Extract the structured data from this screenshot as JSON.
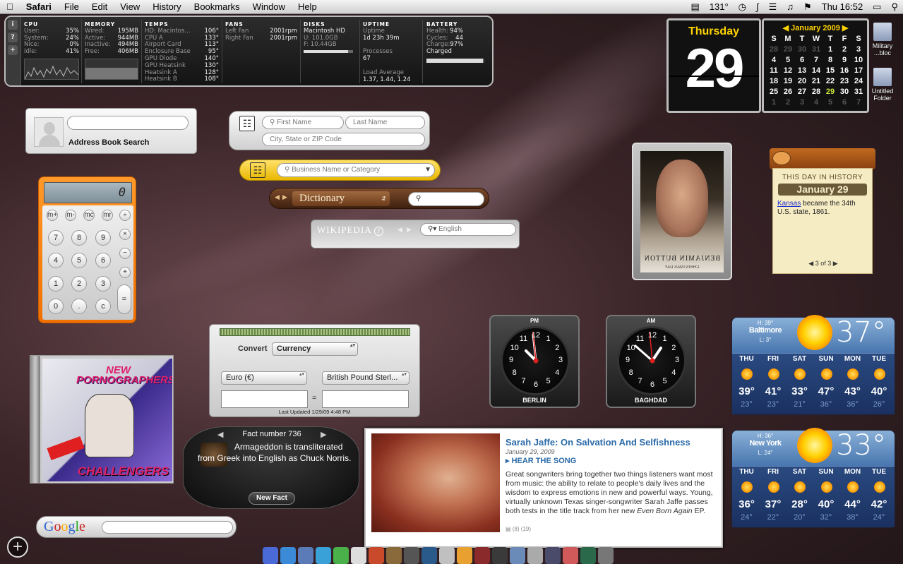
{
  "menubar": {
    "app": "Safari",
    "menus": [
      "File",
      "Edit",
      "View",
      "History",
      "Bookmarks",
      "Window",
      "Help"
    ],
    "temp": "131°",
    "clock": "Thu 16:52"
  },
  "istat": {
    "cpu": {
      "title": "CPU",
      "rows": [
        [
          "User:",
          "35%"
        ],
        [
          "System:",
          "24%"
        ],
        [
          "Nice:",
          "0%"
        ],
        [
          "Idle:",
          "41%"
        ]
      ]
    },
    "memory": {
      "title": "MEMORY",
      "rows": [
        [
          "Wired:",
          "195MB"
        ],
        [
          "Active:",
          "944MB"
        ],
        [
          "Inactive:",
          "494MB"
        ],
        [
          "Free:",
          "406MB"
        ]
      ]
    },
    "temps": {
      "title": "TEMPS",
      "rows": [
        [
          "HD: Macintos...",
          "106°"
        ],
        [
          "CPU A",
          "133°"
        ],
        [
          "Airport Card",
          "113°"
        ],
        [
          "Enclosure Base",
          "95°"
        ],
        [
          "GPU Diode",
          "140°"
        ],
        [
          "GPU Heatsink",
          "130°"
        ],
        [
          "Heatsink A",
          "128°"
        ],
        [
          "Heatsink B",
          "108°"
        ]
      ]
    },
    "fans": {
      "title": "FANS",
      "rows": [
        [
          "Left Fan",
          "2001rpm"
        ],
        [
          "Right Fan",
          "2001rpm"
        ]
      ]
    },
    "disks": {
      "title": "DISKS",
      "name": "Macintosh HD",
      "used": "U: 101.0GB",
      "free": "F: 10.44GB"
    },
    "uptime": {
      "title": "UPTIME",
      "label": "Uptime",
      "value": "1d 23h 39m",
      "proc_label": "Processes",
      "proc": "67",
      "load_label": "Load Average",
      "load": "1.37, 1.44, 1.24"
    },
    "battery": {
      "title": "BATTERY",
      "rows": [
        [
          "Health:",
          "94%"
        ],
        [
          "Cycles:",
          "44"
        ],
        [
          "Charge:",
          "97%"
        ]
      ],
      "status": "Charged"
    }
  },
  "calendar": {
    "weekday": "Thursday",
    "day": "29",
    "month": "January 2009",
    "headers": [
      "S",
      "M",
      "T",
      "W",
      "T",
      "F",
      "S"
    ],
    "weeks": [
      [
        "28",
        "29",
        "30",
        "31",
        "1",
        "2",
        "3"
      ],
      [
        "4",
        "5",
        "6",
        "7",
        "8",
        "9",
        "10"
      ],
      [
        "11",
        "12",
        "13",
        "14",
        "15",
        "16",
        "17"
      ],
      [
        "18",
        "19",
        "20",
        "21",
        "22",
        "23",
        "24"
      ],
      [
        "25",
        "26",
        "27",
        "28",
        "29",
        "30",
        "31"
      ],
      [
        "1",
        "2",
        "3",
        "4",
        "5",
        "6",
        "7"
      ]
    ]
  },
  "address_book": {
    "label": "Address Book Search"
  },
  "people": {
    "first": "First Name",
    "last": "Last Name",
    "city": "City, State or ZIP Code"
  },
  "business": {
    "placeholder": "Business Name or Category"
  },
  "dictionary": {
    "source": "Dictionary"
  },
  "wikipedia": {
    "logo": "WIKIPEDIA",
    "lang": "English"
  },
  "movie": {
    "title": "BENJAMIN BUTTON",
    "date": "CHRISTMAS DAY"
  },
  "history": {
    "heading": "THIS DAY IN HISTORY",
    "date": "January 29",
    "link": "Kansas",
    "text": " became the 34th U.S. state, 1861.",
    "pager": "3 of 3"
  },
  "calculator": {
    "display": "0",
    "mem": [
      "m+",
      "m-",
      "mc",
      "mr"
    ],
    "ops": [
      "÷",
      "×",
      "−",
      "+",
      "="
    ],
    "keys": [
      "7",
      "8",
      "9",
      "4",
      "5",
      "6",
      "1",
      "2",
      "3",
      "0",
      ".",
      "c"
    ]
  },
  "currency": {
    "convert_label": "Convert",
    "type": "Currency",
    "from": "Euro (€)",
    "to": "British Pound Sterl...",
    "updated": "Last Updated 1/29/09 4:48 PM"
  },
  "album": {
    "line1": "NEW",
    "line2": "PORNOGRAPHERS",
    "line3": "CHALLENGERS"
  },
  "clocks": [
    {
      "ampm": "PM",
      "city": "BERLIN"
    },
    {
      "ampm": "AM",
      "city": "BAGHDAD"
    }
  ],
  "clock_numbers": [
    "12",
    "1",
    "2",
    "3",
    "4",
    "5",
    "6",
    "7",
    "8",
    "9",
    "10",
    "11"
  ],
  "fact": {
    "header": "Fact number 736",
    "text": "Armageddon is transliterated from Greek into English as Chuck Norris.",
    "button": "New Fact"
  },
  "npr": {
    "title": "Sarah Jaffe: On Salvation And Selfishness",
    "date": "January 29, 2009",
    "hear": "HEAR THE SONG",
    "body": "Great songwriters bring together two things listeners want most from music: the ability to relate to people's daily lives and the wisdom to express emotions in new and powerful ways. Young, virtually unknown Texas singer-songwriter Sarah Jaffe passes both tests in the title track from her new ",
    "album": "Even Born Again",
    "tail": " EP.",
    "meta": "(8)  (19)"
  },
  "weather": [
    {
      "city": "Baltimore",
      "hilo_hi": "H: 39°",
      "hilo_lo": "L: 3°",
      "now": "37°",
      "days": [
        "THU",
        "FRI",
        "SAT",
        "SUN",
        "MON",
        "TUE"
      ],
      "hi": [
        "39°",
        "41°",
        "33°",
        "47°",
        "43°",
        "40°"
      ],
      "lo": [
        "23°",
        "23°",
        "21°",
        "36°",
        "36°",
        "26°"
      ]
    },
    {
      "city": "New York",
      "hilo_hi": "H: 36°",
      "hilo_lo": "L: 24°",
      "now": "33°",
      "days": [
        "THU",
        "FRI",
        "SAT",
        "SUN",
        "MON",
        "TUE"
      ],
      "hi": [
        "36°",
        "37°",
        "28°",
        "40°",
        "44°",
        "42°"
      ],
      "lo": [
        "24°",
        "22°",
        "20°",
        "32°",
        "38°",
        "24°"
      ]
    }
  ],
  "google": {
    "logo": "Google"
  },
  "desktop_icons": [
    "Military ...bloc",
    "Untitled Folder"
  ]
}
